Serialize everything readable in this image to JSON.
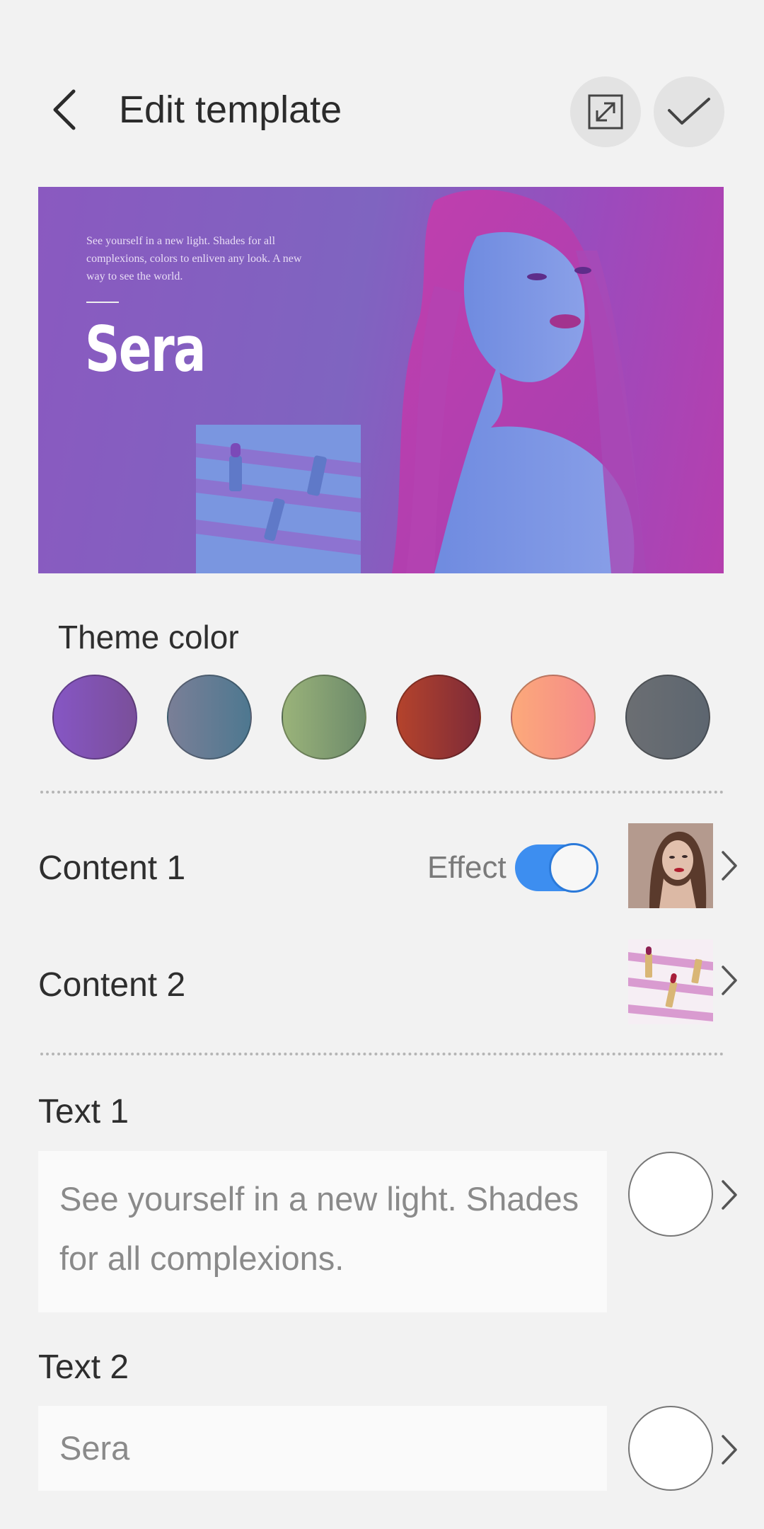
{
  "header": {
    "title": "Edit template",
    "back_icon": "chevron-left-icon",
    "fullscreen_icon": "expand-icon",
    "confirm_icon": "check-icon"
  },
  "preview": {
    "tagline": "See yourself in a new light. Shades for all complexions, colors to enliven any look. A new way to see the world.",
    "brand": "Sera"
  },
  "theme": {
    "title": "Theme color",
    "swatches": [
      {
        "from": "#8656c4",
        "to": "#7a4f9a"
      },
      {
        "from": "#7a7f97",
        "to": "#4e7890"
      },
      {
        "from": "#9ab37a",
        "to": "#6d8a6a"
      },
      {
        "from": "#b4432c",
        "to": "#7e2b38"
      },
      {
        "from": "#fca97a",
        "to": "#f58a8a"
      },
      {
        "from": "#6b6e72",
        "to": "#5d6670"
      }
    ]
  },
  "content": {
    "row1_label": "Content 1",
    "effect_label": "Effect",
    "effect_on": true,
    "row2_label": "Content 2"
  },
  "texts": {
    "text1_label": "Text 1",
    "text1_value": "See yourself in a new light. Shades for all complexions.",
    "text2_label": "Text 2",
    "text2_value": "Sera"
  },
  "colors": {
    "accent": "#3d8ef0",
    "background": "#f2f2f2"
  }
}
